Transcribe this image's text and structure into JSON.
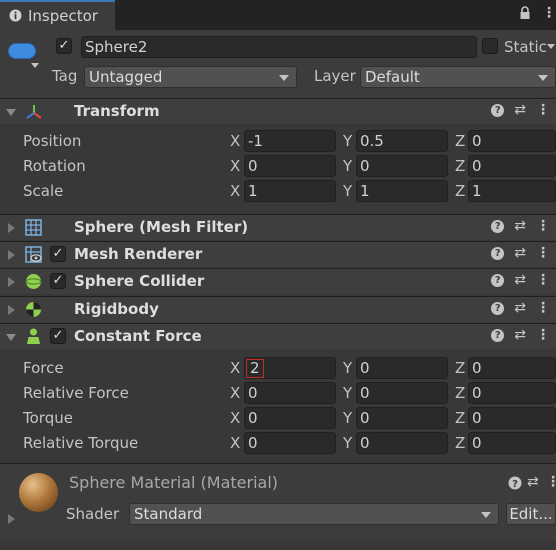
{
  "tab": {
    "label": "Inspector"
  },
  "object": {
    "name": "Sphere2",
    "static_label": "Static",
    "tag_label": "Tag",
    "tag_value": "Untagged",
    "layer_label": "Layer",
    "layer_value": "Default"
  },
  "transform": {
    "title": "Transform",
    "rows": [
      {
        "label": "Position",
        "x": "-1",
        "y": "0.5",
        "z": "0"
      },
      {
        "label": "Rotation",
        "x": "0",
        "y": "0",
        "z": "0"
      },
      {
        "label": "Scale",
        "x": "1",
        "y": "1",
        "z": "1"
      }
    ]
  },
  "components": [
    {
      "title": "Sphere (Mesh Filter)"
    },
    {
      "title": "Mesh Renderer"
    },
    {
      "title": "Sphere Collider"
    },
    {
      "title": "Rigidbody"
    }
  ],
  "constant_force": {
    "title": "Constant Force",
    "rows": [
      {
        "label": "Force",
        "x": "2",
        "y": "0",
        "z": "0"
      },
      {
        "label": "Relative Force",
        "x": "0",
        "y": "0",
        "z": "0"
      },
      {
        "label": "Torque",
        "x": "0",
        "y": "0",
        "z": "0"
      },
      {
        "label": "Relative Torque",
        "x": "0",
        "y": "0",
        "z": "0"
      }
    ]
  },
  "axes": {
    "x": "X",
    "y": "Y",
    "z": "Z"
  },
  "material": {
    "title": "Sphere Material (Material)",
    "shader_label": "Shader",
    "shader_value": "Standard",
    "edit_label": "Edit..."
  },
  "colors": {
    "accent": "#3a79bb",
    "highlight": "#c42b2b"
  }
}
